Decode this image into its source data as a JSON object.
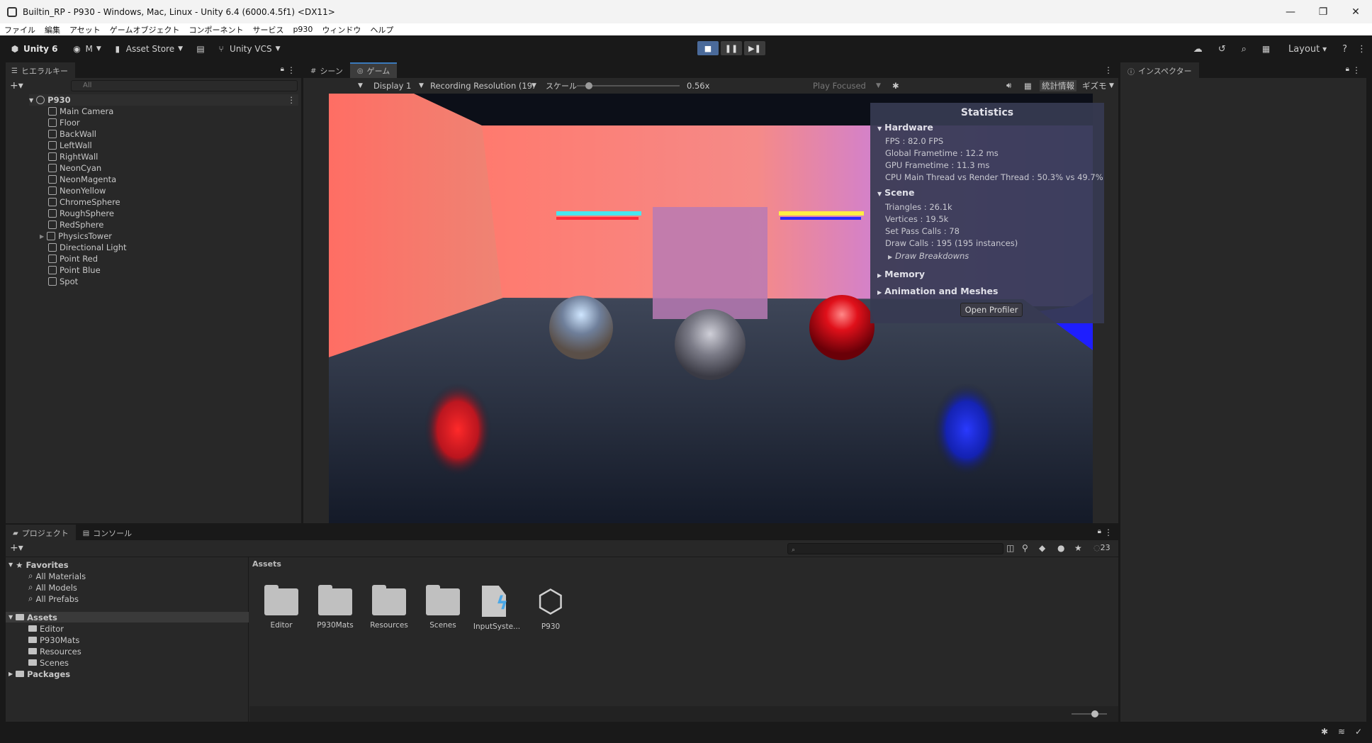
{
  "window": {
    "title": "Builtin_RP - P930 - Windows, Mac, Linux - Unity 6.4 (6000.4.5f1) <DX11>",
    "controls": [
      "—",
      "❐",
      "✕"
    ]
  },
  "menubar": [
    "ファイル",
    "編集",
    "アセット",
    "ゲームオブジェクト",
    "コンポーネント",
    "サービス",
    "p930",
    "ウィンドウ",
    "ヘルプ"
  ],
  "toolbar": {
    "unity_label": "Unity 6",
    "account_label": "M",
    "asset_store_label": "Asset Store",
    "vcs_label": "Unity VCS",
    "layout_label": "Layout"
  },
  "hierarchy": {
    "tab_label": "ヒエラルキー",
    "search_placeholder": "All",
    "scene_name": "P930",
    "items": [
      "Main Camera",
      "Floor",
      "BackWall",
      "LeftWall",
      "RightWall",
      "NeonCyan",
      "NeonMagenta",
      "NeonYellow",
      "ChromeSphere",
      "RoughSphere",
      "RedSphere",
      "PhysicsTower",
      "Directional Light",
      "Point Red",
      "Point Blue",
      "Spot"
    ]
  },
  "game": {
    "tab_scene": "シーン",
    "tab_game": "ゲーム",
    "display": "Display 1",
    "resolution": "Recording Resolution (19:",
    "scale_label": "スケール",
    "scale_value": "0.56x",
    "scale_fraction": 0.12,
    "play_focused": "Play Focused",
    "stats_btn": "統計情報",
    "gizmos_btn": "ギズモ"
  },
  "stats": {
    "title": "Statistics",
    "hardware": "Hardware",
    "fps": "FPS : 82.0 FPS",
    "global_frametime": "Global Frametime : 12.2 ms",
    "gpu_frametime": "GPU Frametime : 11.3 ms",
    "cpu_thread": "CPU Main Thread vs Render Thread : 50.3% vs 49.7%",
    "scene": "Scene",
    "triangles": "Triangles : 26.1k",
    "vertices": "Vertices : 19.5k",
    "set_pass": "Set Pass Calls : 78",
    "draw_calls": "Draw Calls : 195 (195 instances)",
    "draw_breakdowns": "Draw Breakdowns",
    "memory": "Memory",
    "anim": "Animation and Meshes",
    "open_profiler": "Open Profiler"
  },
  "inspector": {
    "tab_label": "インスペクター"
  },
  "project": {
    "tab_project": "プロジェクト",
    "tab_console": "コンソール",
    "favorites": "Favorites",
    "fav_items": [
      "All Materials",
      "All Models",
      "All Prefabs"
    ],
    "assets": "Assets",
    "asset_folders": [
      "Editor",
      "P930Mats",
      "Resources",
      "Scenes"
    ],
    "packages": "Packages",
    "breadcrumb": "Assets",
    "grid_items": [
      "Editor",
      "P930Mats",
      "Resources",
      "Scenes",
      "InputSyste...",
      "P930"
    ],
    "hidden_count": "23"
  }
}
